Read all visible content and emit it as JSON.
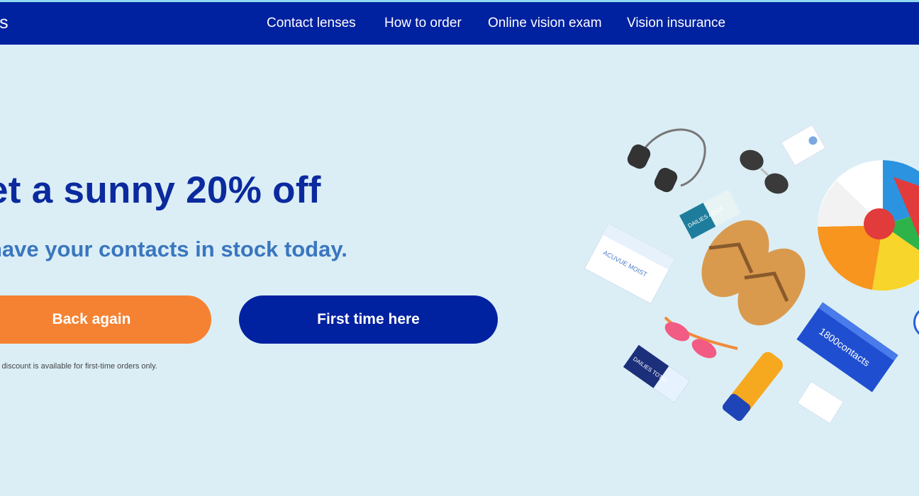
{
  "header": {
    "brand": "ts",
    "nav": [
      {
        "label": "Contact lenses"
      },
      {
        "label": "How to order"
      },
      {
        "label": "Online vision exam"
      },
      {
        "label": "Vision insurance"
      }
    ]
  },
  "hero": {
    "headline": "et a sunny 20% off",
    "subhead": "have your contacts in stock today.",
    "buttons": {
      "back": "Back again",
      "first": "First time here"
    },
    "disclaimer": "s discount is available for first-time orders only."
  },
  "illustration": {
    "product_texts": {
      "box_1800": "1800contacts",
      "acuvue": "ACUVUE MOIST",
      "dailies_aqua": "DAILIES AQUA",
      "dailies_total": "DAILIES TOTAL"
    }
  },
  "colors": {
    "nav_bg": "#0021a0",
    "page_bg": "#dbeef6",
    "headline": "#0b2a9e",
    "subhead": "#3a76bf",
    "back_button": "#f58232",
    "first_button": "#0021a0"
  }
}
